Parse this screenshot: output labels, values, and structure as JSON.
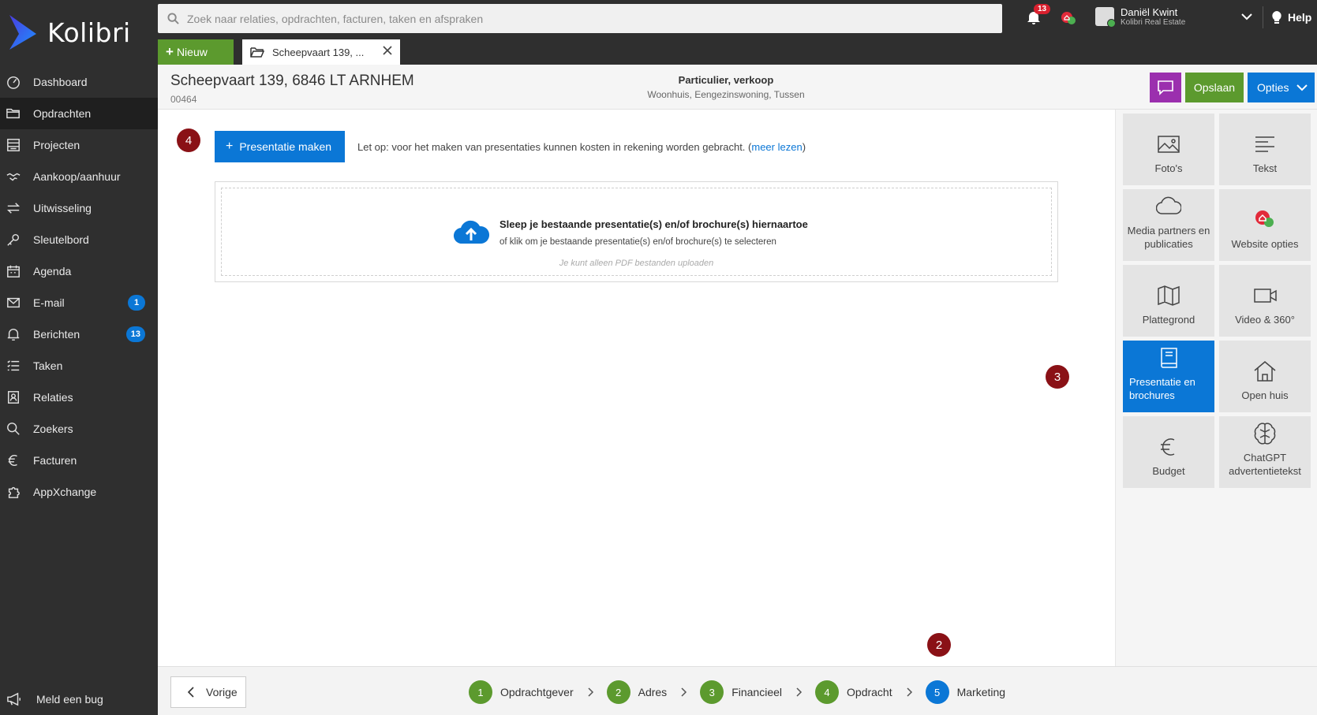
{
  "app": {
    "name": "Kolibri"
  },
  "sidebar": {
    "items": [
      {
        "label": "Dashboard",
        "icon": "dashboard-icon"
      },
      {
        "label": "Opdrachten",
        "icon": "folder-icon",
        "active": true
      },
      {
        "label": "Projecten",
        "icon": "projects-icon"
      },
      {
        "label": "Aankoop/aanhuur",
        "icon": "handshake-icon"
      },
      {
        "label": "Uitwisseling",
        "icon": "exchange-icon"
      },
      {
        "label": "Sleutelbord",
        "icon": "key-icon"
      },
      {
        "label": "Agenda",
        "icon": "calendar-icon"
      },
      {
        "label": "E-mail",
        "icon": "mail-icon",
        "badge": "1"
      },
      {
        "label": "Berichten",
        "icon": "bell-icon",
        "badge": "13"
      },
      {
        "label": "Taken",
        "icon": "tasks-icon"
      },
      {
        "label": "Relaties",
        "icon": "contacts-icon"
      },
      {
        "label": "Zoekers",
        "icon": "search-icon"
      },
      {
        "label": "Facturen",
        "icon": "euro-icon"
      },
      {
        "label": "AppXchange",
        "icon": "puzzle-icon"
      }
    ],
    "bug_label": "Meld een bug"
  },
  "topbar": {
    "search_placeholder": "Zoek naar relaties, opdrachten, facturen, taken en afspraken",
    "notifications_count": "13",
    "user": {
      "name": "Daniël Kwint",
      "org": "Kolibri Real Estate"
    },
    "help_label": "Help"
  },
  "tabs": {
    "new_label": "Nieuw",
    "open_tab_label": "Scheepvaart 139, ..."
  },
  "header": {
    "title": "Scheepvaart 139, 6846 LT ARNHEM",
    "id": "00464",
    "type": "Particulier, verkoop",
    "subtype": "Woonhuis, Eengezinswoning, Tussen",
    "save_label": "Opslaan",
    "options_label": "Opties"
  },
  "main": {
    "present_button": "Presentatie maken",
    "note_text": "Let op: voor het maken van presentaties kunnen kosten in rekening worden gebracht. (",
    "note_link": "meer lezen",
    "note_end": ")",
    "dropzone": {
      "title": "Sleep je bestaande presentatie(s) en/of brochure(s) hiernaartoe",
      "subtitle": "of klik om je bestaande presentatie(s) en/of brochure(s) te selecteren",
      "hint": "Je kunt alleen PDF bestanden uploaden"
    }
  },
  "markers": [
    "4",
    "3",
    "2"
  ],
  "rpanel": {
    "tiles": [
      {
        "label": "Foto's",
        "icon": "image-icon"
      },
      {
        "label": "Tekst",
        "icon": "text-lines-icon"
      },
      {
        "label": "Media partners en publicaties",
        "icon": "cloud-icon"
      },
      {
        "label": "Website opties",
        "icon": "realworks-icon"
      },
      {
        "label": "Plattegrond",
        "icon": "map-icon"
      },
      {
        "label": "Video & 360°",
        "icon": "video-icon"
      },
      {
        "label": "Presentatie en brochures",
        "icon": "book-icon",
        "active": true
      },
      {
        "label": "Open huis",
        "icon": "house-icon"
      },
      {
        "label": "Budget",
        "icon": "euro-icon"
      },
      {
        "label": "ChatGPT advertentietekst",
        "icon": "brain-icon"
      }
    ]
  },
  "footer": {
    "prev_label": "Vorige",
    "steps": [
      {
        "num": "1",
        "label": "Opdrachtgever"
      },
      {
        "num": "2",
        "label": "Adres"
      },
      {
        "num": "3",
        "label": "Financieel"
      },
      {
        "num": "4",
        "label": "Opdracht"
      },
      {
        "num": "5",
        "label": "Marketing",
        "current": true
      }
    ]
  },
  "colors": {
    "sidebar_bg": "#2f2f2f",
    "green": "#5c9a2e",
    "blue": "#0b77d6",
    "purple": "#9b2fae",
    "marker": "#8a1116"
  }
}
